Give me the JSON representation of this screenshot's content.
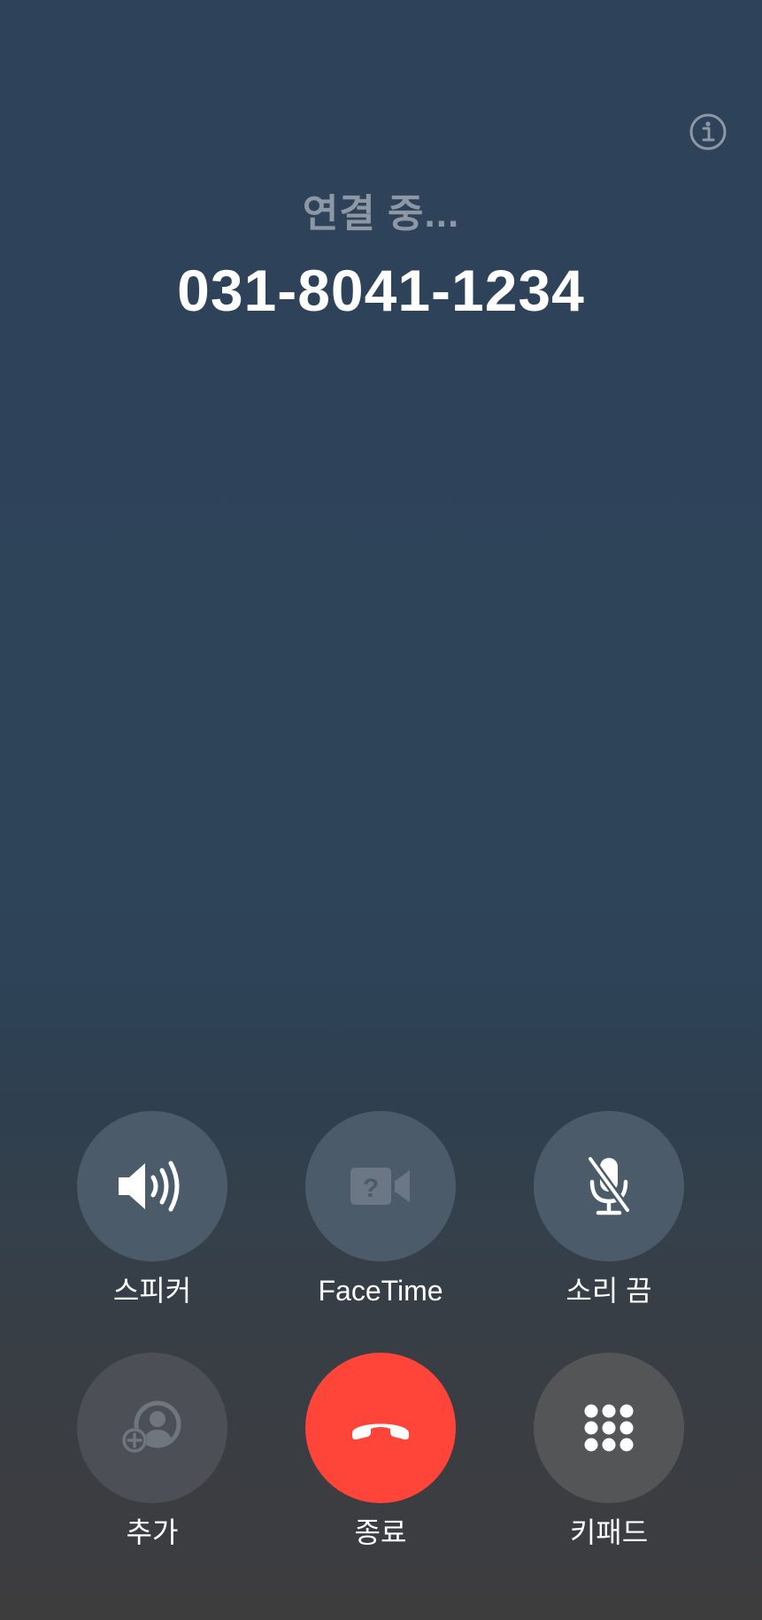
{
  "call": {
    "status": "연결 중...",
    "number": "031-8041-1234"
  },
  "controls": {
    "speaker": {
      "label": "스피커",
      "icon": "speaker-icon"
    },
    "facetime": {
      "label": "FaceTime",
      "icon": "video-unavailable-icon"
    },
    "mute": {
      "label": "소리 끔",
      "icon": "mic-slash-icon"
    },
    "add": {
      "label": "추가",
      "icon": "add-person-icon"
    },
    "end": {
      "label": "종료",
      "icon": "phone-hangup-icon"
    },
    "keypad": {
      "label": "키패드",
      "icon": "keypad-icon"
    }
  },
  "colors": {
    "end_button": "#ff453a",
    "status_text": "#8e98a5"
  }
}
